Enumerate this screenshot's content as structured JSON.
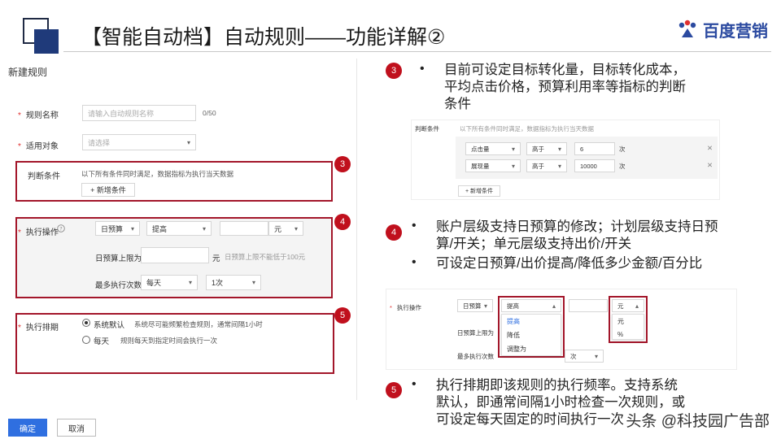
{
  "header": {
    "title": "【智能自动档】自动规则——功能详解②",
    "brand": "百度营销"
  },
  "form": {
    "title": "新建规则",
    "rule_name": {
      "label": "规则名称",
      "placeholder": "请输入自动规则名称",
      "counter": "0/50"
    },
    "target": {
      "label": "适用对象",
      "placeholder": "请选择"
    },
    "condition": {
      "label": "判断条件",
      "desc": "以下所有条件同时满足，数据指标为执行当天数据",
      "add_button": "+ 新增条件"
    },
    "action": {
      "label": "执行操作",
      "select1": "日预算",
      "select2": "提高",
      "unit": "元",
      "limit_label": "日预算上限为",
      "limit_unit": "元",
      "limit_hint": "日预算上限不能低于100元",
      "freq_label": "最多执行次数",
      "freq_select1": "每天",
      "freq_select2": "1次"
    },
    "schedule": {
      "label": "执行排期",
      "opt1": "系统默认",
      "opt1_desc": "系统尽可能频繁检查规则，通常间隔1小时",
      "opt2": "每天",
      "opt2_desc": "规则每天到指定时间会执行一次"
    },
    "confirm": "确定",
    "cancel": "取消"
  },
  "markers": {
    "m3": "3",
    "m4": "4",
    "m5": "5"
  },
  "notes": {
    "note3": [
      "目前可设定目标转化量，目标转化成本，",
      "平均点击价格，预算利用率等指标的判断",
      "条件"
    ],
    "note4a": [
      "账户层级支持日预算的修改；计划层级支持日预",
      "算/开关；单元层级支持出价/开关"
    ],
    "note4b": "可设定日预算/出价提高/降低多少金额/百分比",
    "note5": [
      "执行排期即该规则的执行频率。支持系统",
      "默认，即通常间隔1小时检查一次规则，或",
      "可设定每天固定的时间执行一次"
    ]
  },
  "shot3": {
    "label": "判断条件",
    "desc": "以下所有条件同时满足，数据指标为执行当天数据",
    "rows": [
      {
        "metric": "点击量",
        "op": "高于",
        "value": "6",
        "unit": "次"
      },
      {
        "metric": "展现量",
        "op": "高于",
        "value": "10000",
        "unit": "次"
      }
    ],
    "add": "+ 新增条件"
  },
  "shot4": {
    "label": "执行操作",
    "select1": "日预算",
    "select2": "提高",
    "menu": [
      "提高",
      "降低",
      "调整为"
    ],
    "unit": "元",
    "unit_menu": [
      "元",
      "%"
    ],
    "limit_label": "日预算上限为",
    "freq_label": "最多执行次数",
    "freq_value": "次"
  },
  "watermark": "头条 @科技园广告部",
  "colors": {
    "accent": "#2f6fe0",
    "marker": "#c0101d",
    "box": "#a3162a",
    "brand": "#2b4aa0"
  }
}
